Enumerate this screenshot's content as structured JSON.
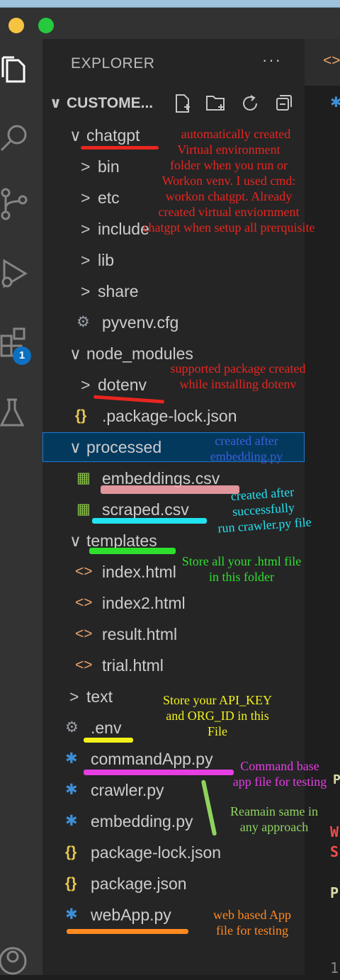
{
  "explorer": {
    "title": "EXPLORER",
    "more": "···",
    "workspace": "CUSTOME...",
    "tab_icon": "<>",
    "editor_fragments": {
      "p": "P",
      "w": "W",
      "s": "S",
      "p2": "P",
      "num": "1"
    }
  },
  "icons": {
    "explorer": "files-icon",
    "search": "search-icon",
    "scm": "source-control-icon",
    "debug": "run-debug-icon",
    "extensions": "extensions-icon",
    "testing": "flask-icon",
    "account": "account-icon",
    "new_file": "new-file-icon",
    "new_folder": "new-folder-icon",
    "refresh": "refresh-icon",
    "collapse": "collapse-all-icon"
  },
  "extensions_badge": "1",
  "tree": [
    {
      "label": "chatgpt",
      "type": "folder",
      "open": true
    },
    {
      "label": "bin",
      "type": "folder",
      "open": false
    },
    {
      "label": "etc",
      "type": "folder",
      "open": false
    },
    {
      "label": "include",
      "type": "folder",
      "open": false
    },
    {
      "label": "lib",
      "type": "folder",
      "open": false
    },
    {
      "label": "share",
      "type": "folder",
      "open": false
    },
    {
      "label": "pyvenv.cfg",
      "type": "config"
    },
    {
      "label": "node_modules",
      "type": "folder",
      "open": true
    },
    {
      "label": "dotenv",
      "type": "folder",
      "open": false
    },
    {
      "label": ".package-lock.json",
      "type": "json"
    },
    {
      "label": "processed",
      "type": "folder",
      "open": true
    },
    {
      "label": "embeddings.csv",
      "type": "csv"
    },
    {
      "label": "scraped.csv",
      "type": "csv"
    },
    {
      "label": "templates",
      "type": "folder",
      "open": true
    },
    {
      "label": "index.html",
      "type": "html"
    },
    {
      "label": "index2.html",
      "type": "html"
    },
    {
      "label": "result.html",
      "type": "html"
    },
    {
      "label": "trial.html",
      "type": "html"
    },
    {
      "label": "text",
      "type": "folder",
      "open": false
    },
    {
      "label": ".env",
      "type": "config"
    },
    {
      "label": "commandApp.py",
      "type": "python"
    },
    {
      "label": "crawler.py",
      "type": "python"
    },
    {
      "label": "embedding.py",
      "type": "python"
    },
    {
      "label": "package-lock.json",
      "type": "json"
    },
    {
      "label": "package.json",
      "type": "json"
    },
    {
      "label": "webApp.py",
      "type": "python"
    }
  ],
  "annotations": {
    "chatgpt": [
      "automatically created",
      "Virtual environment",
      "folder when you run or",
      "Workon venv. I used cmd:",
      "workon chatgpt. Already",
      "created virtual enviornment",
      "chatgpt when setup all prerquisite"
    ],
    "dotenv": [
      "supported package created",
      "while installing dotenv"
    ],
    "processed": [
      "created after",
      "embedding.py"
    ],
    "csv": [
      "created after",
      "successfully",
      "run crawler.py file"
    ],
    "templates": [
      "Store all your .html file",
      "in this folder"
    ],
    "env": [
      "Store your API_KEY",
      "and ORG_ID in this",
      "File"
    ],
    "command": [
      "Command base",
      "app file for testing"
    ],
    "remain": [
      "Reamain same in",
      "any approach"
    ],
    "web": [
      "web based App",
      "file for testing"
    ]
  },
  "colors": {
    "red": "#e8261f",
    "blue_ann": "#3b5fd8",
    "cyan": "#22e3f0",
    "green": "#2ee02e",
    "yellow": "#f2f21a",
    "magenta": "#e63ee3",
    "light_green": "#8fd35e",
    "orange": "#ff8a1f",
    "pink": "#f5a3a8",
    "csv_icon": "#8bc34a",
    "json_icon": "#e8c94f",
    "python_icon": "#3e8fd6",
    "html_icon": "#e7a36d"
  }
}
